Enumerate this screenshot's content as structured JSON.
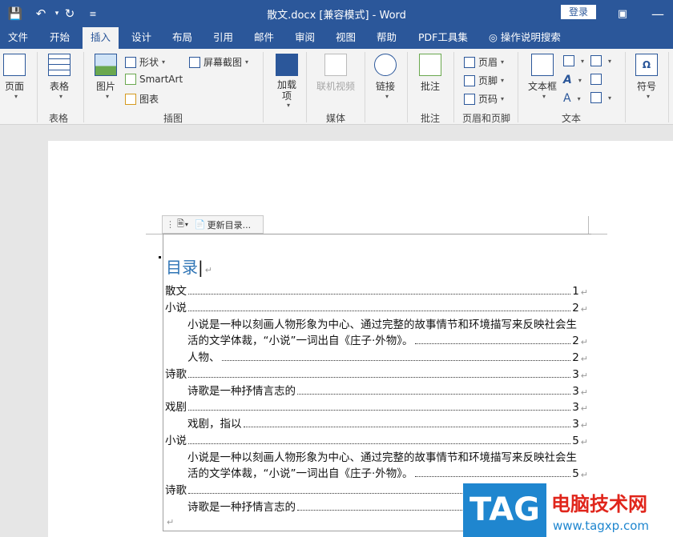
{
  "titlebar": {
    "title": "散文.docx [兼容模式]  -  Word",
    "login": "登录"
  },
  "tabs": [
    "文件",
    "开始",
    "插入",
    "设计",
    "布局",
    "引用",
    "邮件",
    "审阅",
    "视图",
    "帮助",
    "PDF工具集",
    "操作说明搜索"
  ],
  "active_tab": "插入",
  "ribbon": {
    "page": {
      "label": "页面",
      "group": ""
    },
    "table": {
      "label": "表格",
      "group": "表格"
    },
    "picture": "图片",
    "shape": "形状",
    "screenshot": "屏幕截图",
    "smartart": "SmartArt",
    "chart": "图表",
    "illus_group": "插图",
    "addin": "加载项",
    "video": "联机视频",
    "media_group": "媒体",
    "link": "链接",
    "comment": "批注",
    "comment_group": "批注",
    "header": "页眉",
    "footer": "页脚",
    "pagenum": "页码",
    "hf_group": "页眉和页脚",
    "textbox": "文本框",
    "text_group": "文本",
    "symbol": "符号"
  },
  "toc_toolbar": {
    "update": "更新目录..."
  },
  "toc": {
    "title": "目录",
    "lines": [
      {
        "text": "散文",
        "page": "1",
        "level": 1
      },
      {
        "text": "小说",
        "page": "2",
        "level": 1
      },
      {
        "text": "活的文学体裁，“小说”一词出自《庄子·外物》。",
        "page": "2",
        "level": 2,
        "pre": "小说是一种以刻画人物形象为中心、通过完整的故事情节和环境描写来反映社会生"
      },
      {
        "text": "人物、",
        "page": "2",
        "level": 2
      },
      {
        "text": "诗歌",
        "page": "3",
        "level": 1
      },
      {
        "text": "诗歌是一种抒情言志的",
        "page": "3",
        "level": 2
      },
      {
        "text": "戏剧",
        "page": "3",
        "level": 1
      },
      {
        "text": "戏剧，指以",
        "page": "3",
        "level": 2
      },
      {
        "text": "小说",
        "page": "5",
        "level": 1
      },
      {
        "text": "活的文学体裁，“小说”一词出自《庄子·外物》。",
        "page": "5",
        "level": 2,
        "pre": "小说是一种以刻画人物形象为中心、通过完整的故事情节和环境描写来反映社会生"
      },
      {
        "text": "诗歌",
        "page": "",
        "level": 1
      },
      {
        "text": "诗歌是一种抒情言志的",
        "page": "",
        "level": 2
      }
    ]
  },
  "watermark": {
    "tag": "TAG",
    "cn": "电脑技术网",
    "url": "www.tagxp.com"
  }
}
